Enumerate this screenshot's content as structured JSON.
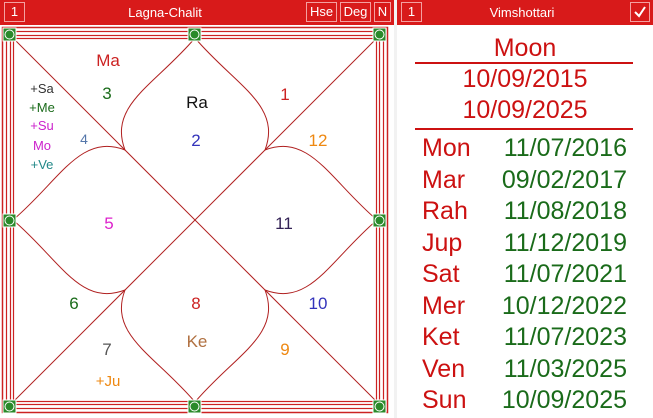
{
  "left_panel": {
    "number_button": "1",
    "title": "Lagna-Chalit",
    "buttons": [
      "Hse",
      "Deg",
      "N"
    ]
  },
  "chart": {
    "houses": [
      "1",
      "2",
      "3",
      "4",
      "5",
      "6",
      "7",
      "8",
      "9",
      "10",
      "11",
      "12"
    ],
    "planets": {
      "ma": "Ma",
      "ra": "Ra",
      "sa": "+Sa",
      "me": "+Me",
      "su": "+Su",
      "mo": "Mo",
      "ve": "+Ve",
      "ke": "Ke",
      "ju": "+Ju"
    },
    "colors": {
      "border": "#cc2222",
      "lines": "#b02020",
      "node_fill": "#2a8a2a"
    }
  },
  "right_panel": {
    "number_button": "1",
    "title": "Vimshottari",
    "check_icon": "checkmark-icon",
    "dasha": {
      "lord": "Moon",
      "start": "10/09/2015",
      "end": "10/09/2025",
      "periods": [
        {
          "planet": "Mon",
          "date": "11/07/2016"
        },
        {
          "planet": "Mar",
          "date": "09/02/2017"
        },
        {
          "planet": "Rah",
          "date": "11/08/2018"
        },
        {
          "planet": "Jup",
          "date": "11/12/2019"
        },
        {
          "planet": "Sat",
          "date": "11/07/2021"
        },
        {
          "planet": "Mer",
          "date": "10/12/2022"
        },
        {
          "planet": "Ket",
          "date": "11/07/2023"
        },
        {
          "planet": "Ven",
          "date": "11/03/2025"
        },
        {
          "planet": "Sun",
          "date": "10/09/2025"
        }
      ]
    }
  }
}
